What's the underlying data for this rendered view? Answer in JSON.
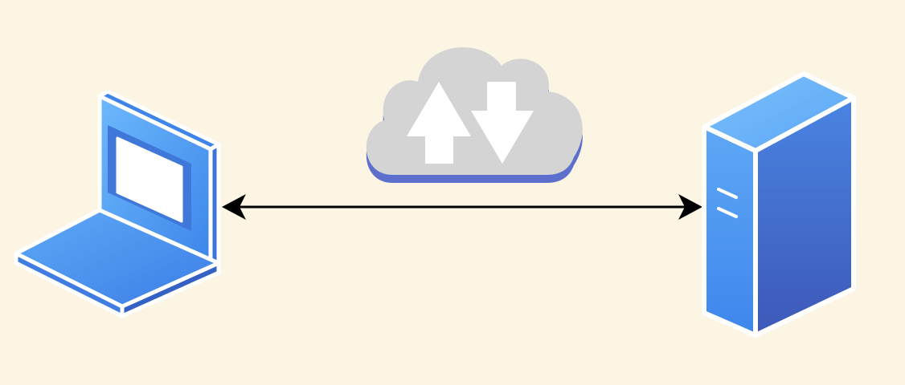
{
  "colors": {
    "background": "#FDF5E4",
    "device_blue_light": "#5FAEFA",
    "device_blue_mid": "#3F8CEC",
    "device_blue_dark": "#3C62C2",
    "device_outline": "#FFFFFF",
    "screen_fill": "#FFFFFF",
    "cloud_fill": "#D4D4D4",
    "cloud_shadow": "#5C6FCC",
    "arrow_glyph_fill": "#FFFFFF",
    "connector_line": "#000000"
  },
  "nodes": [
    {
      "id": "laptop",
      "icon": "laptop-icon"
    },
    {
      "id": "cloud",
      "icon": "cloud-upload-download-icon"
    },
    {
      "id": "server",
      "icon": "server-tower-icon"
    }
  ],
  "connection": {
    "from": "laptop",
    "to": "server",
    "direction": "bidirectional"
  }
}
